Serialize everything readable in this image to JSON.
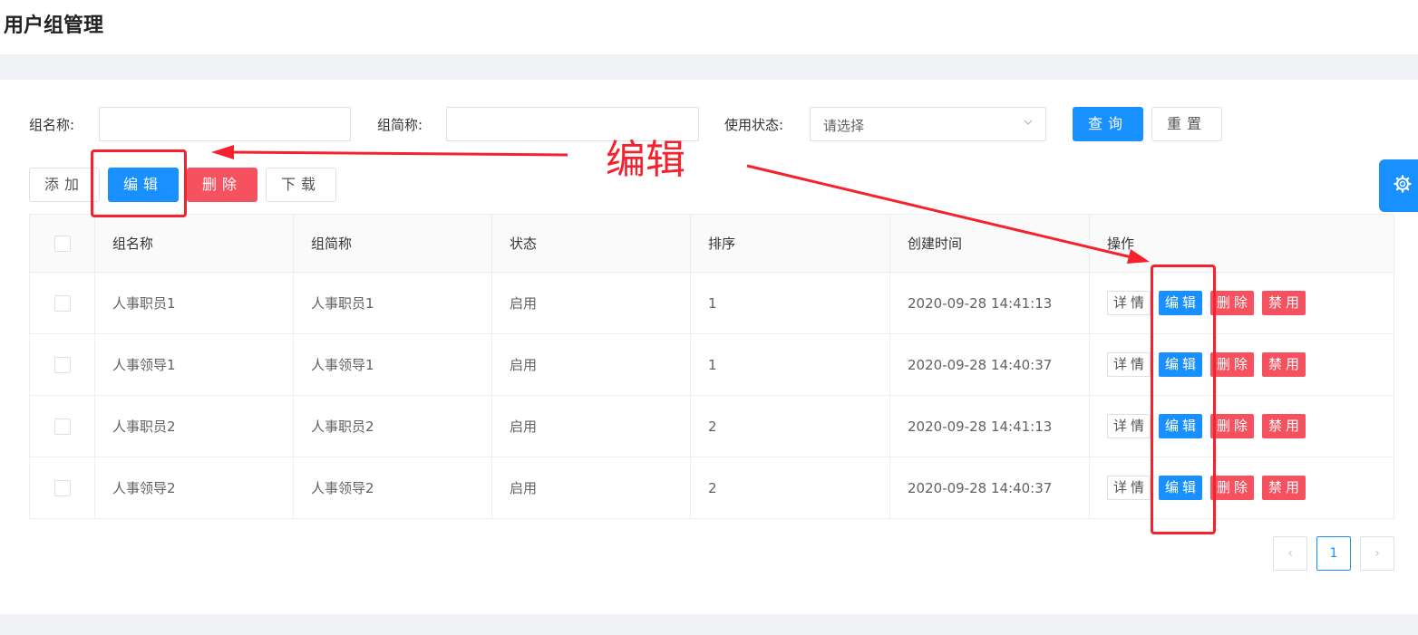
{
  "page_title": "用户组管理",
  "search": {
    "group_name_label": "组名称:",
    "group_abbr_label": "组简称:",
    "status_label": "使用状态:",
    "status_placeholder": "请选择",
    "query_button": "查询",
    "reset_button": "重置"
  },
  "toolbar": {
    "add_button": "添加",
    "edit_button": "编辑",
    "delete_button": "删除",
    "download_button": "下载"
  },
  "table": {
    "headers": [
      "组名称",
      "组简称",
      "状态",
      "排序",
      "创建时间",
      "操作"
    ],
    "rows": [
      {
        "name": "人事职员1",
        "abbr": "人事职员1",
        "status": "启用",
        "order": "1",
        "created": "2020-09-28 14:41:13"
      },
      {
        "name": "人事领导1",
        "abbr": "人事领导1",
        "status": "启用",
        "order": "1",
        "created": "2020-09-28 14:40:37"
      },
      {
        "name": "人事职员2",
        "abbr": "人事职员2",
        "status": "启用",
        "order": "2",
        "created": "2020-09-28 14:41:13"
      },
      {
        "name": "人事领导2",
        "abbr": "人事领导2",
        "status": "启用",
        "order": "2",
        "created": "2020-09-28 14:40:37"
      }
    ],
    "row_actions": {
      "detail": "详情",
      "edit": "编辑",
      "delete": "删除",
      "disable": "禁用"
    }
  },
  "pagination": {
    "prev": "‹",
    "current_page": "1",
    "next": "›"
  },
  "annotation": {
    "text": "编辑",
    "color": "#f5222d"
  },
  "colors": {
    "primary": "#1890ff",
    "danger": "#f5515f"
  }
}
